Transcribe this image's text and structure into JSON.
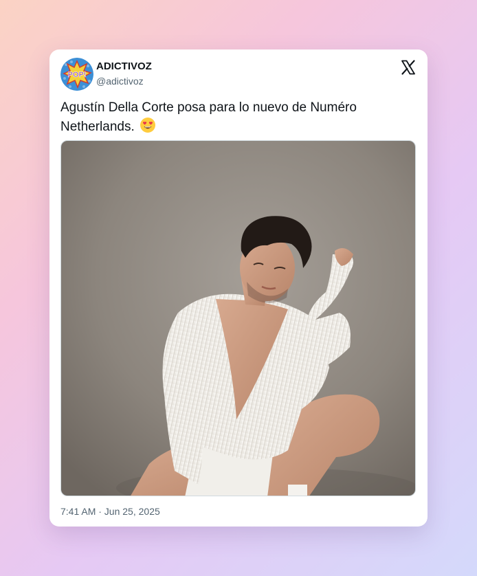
{
  "author": {
    "display_name": "ADICTIVOZ",
    "handle": "@adictivoz",
    "avatar_text": "POP!"
  },
  "platform": {
    "icon": "x-logo-icon"
  },
  "tweet": {
    "text": "Agustín Della Corte posa para lo nuevo de Numéro Netherlands.",
    "emoji": "smiling-face-with-heart-eyes-icon"
  },
  "media": {
    "description_icon": "photo-icon"
  },
  "meta": {
    "timestamp": "7:41 AM · Jun 25, 2025"
  },
  "colors": {
    "text_primary": "#0f1419",
    "text_secondary": "#536471",
    "card_bg": "#ffffff"
  }
}
